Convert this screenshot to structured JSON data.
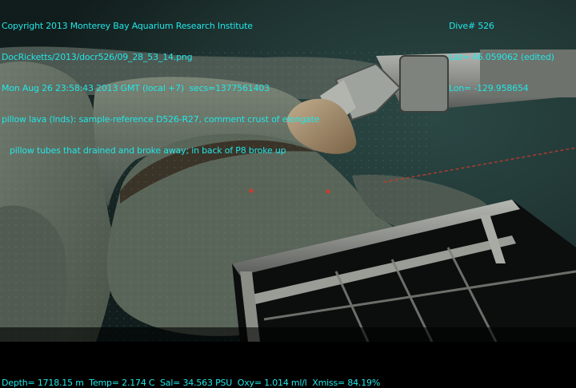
{
  "overlay": {
    "left_lines": [
      "Copyright 2013 Monterey Bay Aquarium Research Institute",
      "DocRicketts/2013/docr526/09_28_53_14.png",
      "Mon Aug 26 23:58:43 2013 GMT (local +7)  secs=1377561403",
      "pillow lava (lnds): sample-reference D526-R27, comment crust of elongate",
      "pillow tubes that drained and broke away; in back of P8 broke up"
    ],
    "right_lines": [
      "Dive# 526",
      "Lat= 46.059062 (edited)",
      "Lon= -129.958654"
    ],
    "bottom_line": "Depth= 1718.15 m  Temp= 2.174 C  Sal= 34.563 PSU  Oxy= 1.014 ml/l  Xmiss= 84.19%",
    "text_color": "#22e6e6"
  },
  "scene": {
    "water_color": "#1f3432",
    "rock_color": "#5f6a60",
    "laser_color": "#d03a2a"
  }
}
